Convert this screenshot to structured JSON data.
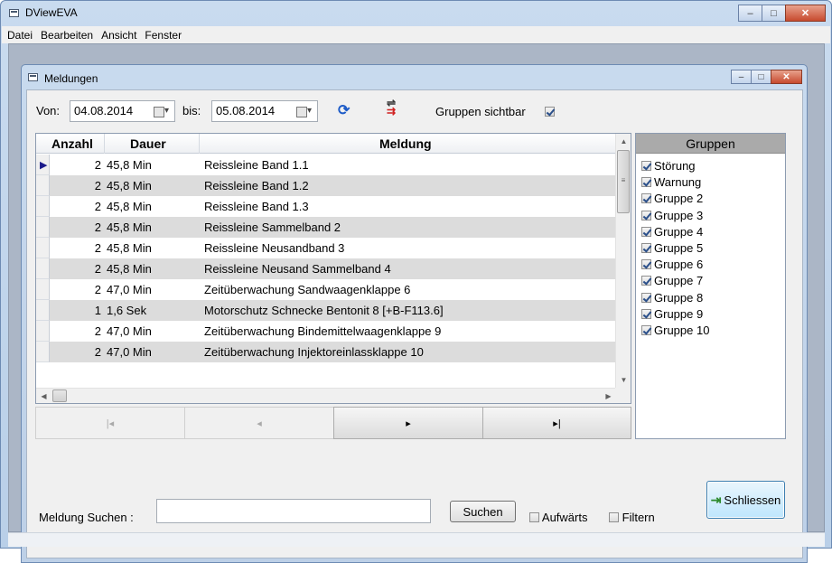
{
  "app": {
    "title": "DViewEVA",
    "window_buttons": [
      "–",
      "□",
      "✕"
    ]
  },
  "menu": {
    "items": [
      "Datei",
      "Bearbeiten",
      "Ansicht",
      "Fenster"
    ]
  },
  "child_window": {
    "title": "Meldungen",
    "window_buttons": [
      "–",
      "□",
      "✕"
    ]
  },
  "toolbar": {
    "von_label": "Von:",
    "von_value": "04.08.2014",
    "bis_label": "bis:",
    "bis_value": "05.08.2014",
    "gruppen_label": "Gruppen sichtbar",
    "gruppen_checked": true
  },
  "table": {
    "headers": {
      "anzahl": "Anzahl",
      "dauer": "Dauer",
      "meldung": "Meldung"
    },
    "rows": [
      {
        "anzahl": "2",
        "dauer": "45,8 Min",
        "meldung": "Reissleine Band 1.1"
      },
      {
        "anzahl": "2",
        "dauer": "45,8 Min",
        "meldung": "Reissleine Band 1.2"
      },
      {
        "anzahl": "2",
        "dauer": "45,8 Min",
        "meldung": "Reissleine Band 1.3"
      },
      {
        "anzahl": "2",
        "dauer": "45,8 Min",
        "meldung": "Reissleine Sammelband 2"
      },
      {
        "anzahl": "2",
        "dauer": "45,8 Min",
        "meldung": "Reissleine Neusandband 3"
      },
      {
        "anzahl": "2",
        "dauer": "45,8 Min",
        "meldung": "Reissleine Neusand Sammelband 4"
      },
      {
        "anzahl": "2",
        "dauer": "47,0 Min",
        "meldung": "Zeitüberwachung Sandwaagenklappe 6"
      },
      {
        "anzahl": "1",
        "dauer": "1,6 Sek",
        "meldung": "Motorschutz Schnecke Bentonit 8 [+B-F113.6]"
      },
      {
        "anzahl": "2",
        "dauer": "47,0 Min",
        "meldung": "Zeitüberwachung Bindemittelwaagenklappe 9"
      },
      {
        "anzahl": "2",
        "dauer": "47,0 Min",
        "meldung": "Zeitüberwachung Injektoreinlassklappe 10"
      }
    ]
  },
  "nav": {
    "first": "|◂",
    "prev": "◂",
    "next": "▸",
    "last": "▸|"
  },
  "groups": {
    "header": "Gruppen",
    "items": [
      "Störung",
      "Warnung",
      "Gruppe 2",
      "Gruppe 3",
      "Gruppe 4",
      "Gruppe 5",
      "Gruppe 6",
      "Gruppe 7",
      "Gruppe 8",
      "Gruppe 9",
      "Gruppe 10"
    ]
  },
  "search": {
    "label": "Meldung Suchen :",
    "value": "",
    "button": "Suchen",
    "aufwaerts": "Aufwärts",
    "filtern": "Filtern"
  },
  "close_button": "Schliessen",
  "colors": {
    "row_alt": "#dcdcdc",
    "groups_header": "#aaaaaa",
    "title_bg": "#c9dbef"
  }
}
